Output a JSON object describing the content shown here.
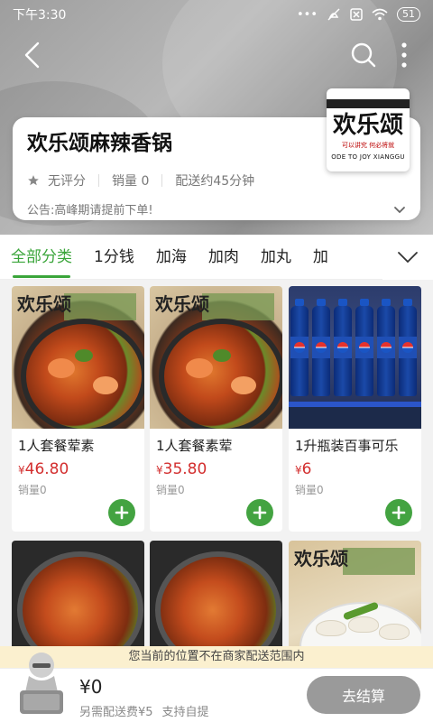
{
  "status_bar": {
    "time": "下午3:30",
    "battery": "51"
  },
  "shop": {
    "name": "欢乐颂麻辣香锅",
    "rating_text": "无评分",
    "sales": "销量 0",
    "delivery_time": "配送约45分钟",
    "notice": "公告:高峰期请提前下单!",
    "logo_text": "欢乐颂",
    "logo_slogan": "可以讲究 何必将就",
    "logo_en": "ODE TO JOY XIANGGU"
  },
  "tabs": [
    {
      "label": "全部分类",
      "active": true
    },
    {
      "label": "1分钱"
    },
    {
      "label": "加海"
    },
    {
      "label": "加肉"
    },
    {
      "label": "加丸"
    },
    {
      "label": "加"
    }
  ],
  "products": [
    {
      "name": "1人套餐荤素",
      "currency": "¥",
      "price": "46.80",
      "sales": "销量0",
      "image": "spicy-pot"
    },
    {
      "name": "1人套餐素荤",
      "currency": "¥",
      "price": "35.80",
      "sales": "销量0",
      "image": "spicy-pot"
    },
    {
      "name": "1升瓶装百事可乐",
      "currency": "¥",
      "price": "6",
      "sales": "销量0",
      "image": "pepsi-bottles"
    },
    {
      "image": "spicy-pot"
    },
    {
      "image": "spicy-pot"
    },
    {
      "image": "dumplings"
    }
  ],
  "range_notice": "您当前的位置不在商家配送范围内",
  "cart": {
    "total": "¥0",
    "delivery_fee": "另需配送费¥5",
    "self_pickup": "支持自提",
    "checkout_label": "去结算"
  },
  "colors": {
    "accent": "#3aa53a",
    "price": "#d32f2f",
    "checkout_disabled": "#9a9a9a"
  }
}
